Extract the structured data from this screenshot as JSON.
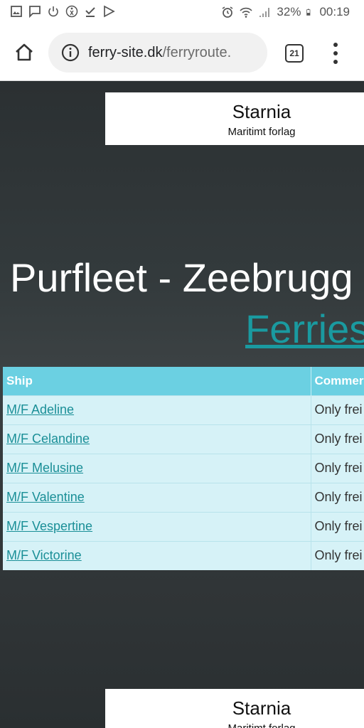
{
  "status_bar": {
    "battery": "32%",
    "time": "00:19",
    "left_icons": [
      "gallery-icon",
      "message-icon",
      "power-icon",
      "accessibility-icon",
      "download-done-icon",
      "play-store-icon"
    ],
    "right_icons": [
      "alarm-icon",
      "wifi-icon",
      "signal-icon",
      "battery-icon"
    ]
  },
  "browser": {
    "url_host": "ferry-site.dk",
    "url_path": "/ferryroute.",
    "tab_count": "21"
  },
  "banner": {
    "title": "Starnia",
    "subtitle": "Maritimt forlag"
  },
  "route": {
    "title": "Purfleet - Zeebrugg",
    "link": "Ferries"
  },
  "table": {
    "headers": [
      "Ship",
      "Commer"
    ],
    "rows": [
      {
        "ship": "M/F Adeline",
        "comment": "Only frei"
      },
      {
        "ship": "M/F Celandine",
        "comment": "Only frei"
      },
      {
        "ship": "M/F Melusine",
        "comment": "Only frei"
      },
      {
        "ship": "M/F Valentine",
        "comment": "Only frei"
      },
      {
        "ship": "M/F Vespertine",
        "comment": "Only frei"
      },
      {
        "ship": "M/F Victorine",
        "comment": "Only frei"
      }
    ]
  },
  "colors": {
    "header_bg": "#6bd0e2",
    "row_bg": "#d6f2f7",
    "link": "#1a8f97",
    "ferries_link": "#1a9aa0"
  }
}
